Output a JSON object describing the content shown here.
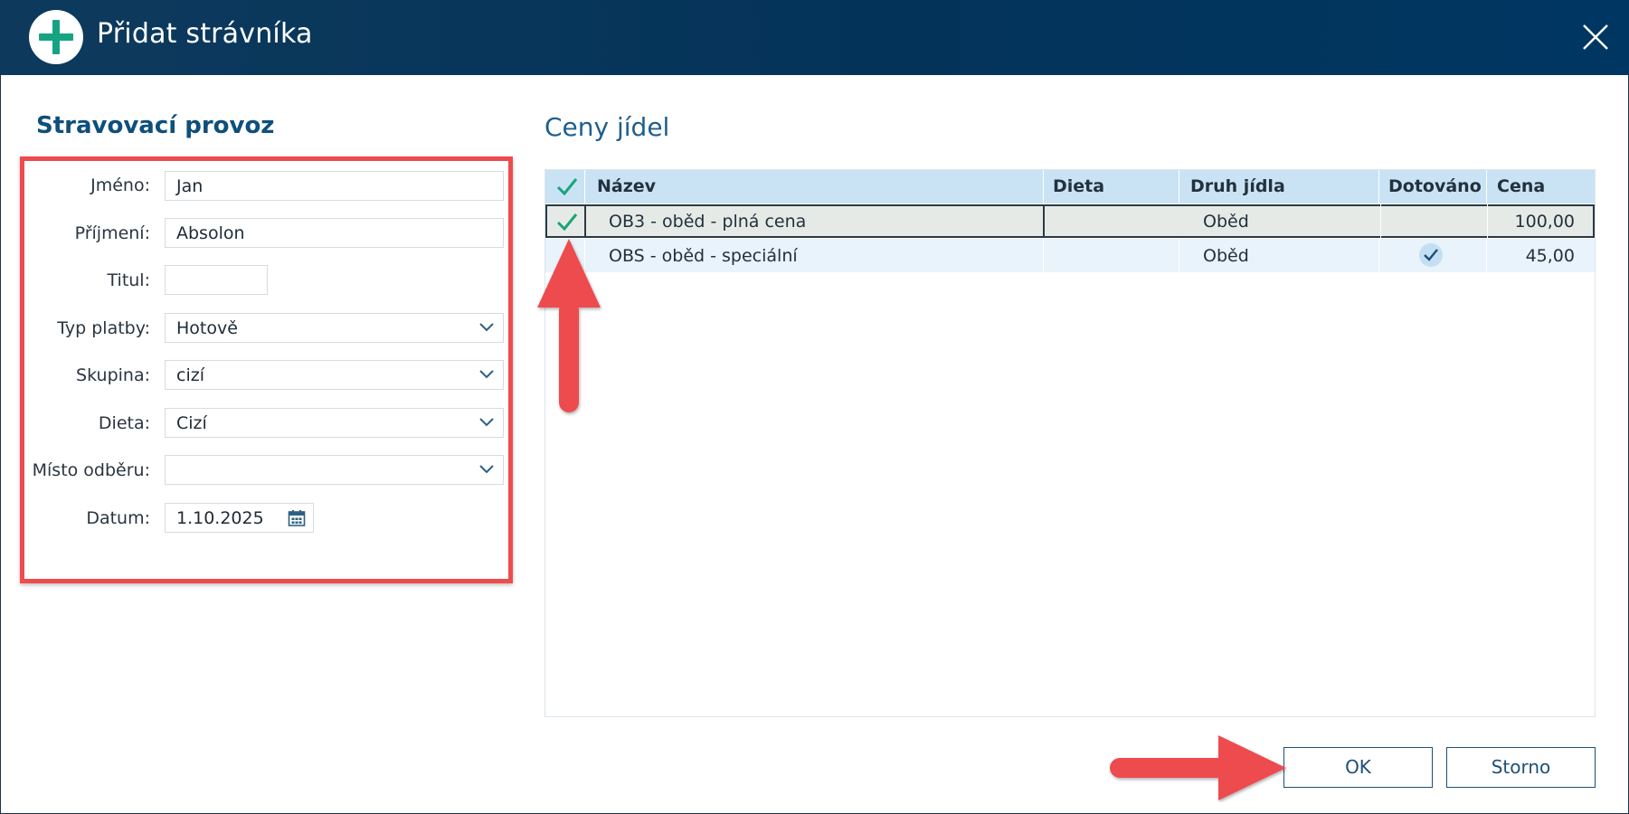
{
  "window": {
    "title": "Přidat strávníka"
  },
  "form": {
    "section_title": "Stravovací provoz",
    "fields": {
      "jmeno": {
        "label": "Jméno:",
        "value": "Jan"
      },
      "prijmeni": {
        "label": "Příjmení:",
        "value": "Absolon"
      },
      "titul": {
        "label": "Titul:",
        "value": ""
      },
      "typ_platby": {
        "label": "Typ platby:",
        "value": "Hotově"
      },
      "skupina": {
        "label": "Skupina:",
        "value": "cizí"
      },
      "dieta": {
        "label": "Dieta:",
        "value": "Cizí"
      },
      "misto_odberu": {
        "label": "Místo odběru:",
        "value": ""
      },
      "datum": {
        "label": "Datum:",
        "value": "1.10.2025"
      }
    }
  },
  "prices": {
    "title": "Ceny jídel",
    "columns": {
      "nazev": "Název",
      "dieta": "Dieta",
      "druh": "Druh jídla",
      "dotovano": "Dotováno",
      "cena": "Cena"
    },
    "rows": [
      {
        "selected": true,
        "nazev": "OB3 - oběd - plná cena",
        "dieta": "",
        "druh": "Oběd",
        "dotovano": false,
        "cena": "100,00"
      },
      {
        "selected": false,
        "nazev": "OBS - oběd - speciální",
        "dieta": "",
        "druh": "Oběd",
        "dotovano": true,
        "cena": "45,00"
      }
    ]
  },
  "buttons": {
    "ok": "OK",
    "storno": "Storno"
  },
  "colors": {
    "accent": "#0e4f7c",
    "titlebar": "#04335a",
    "check": "#1aa37a",
    "annotation": "#ee4b4f"
  },
  "icons": {
    "title": "plus-circle-icon",
    "close": "close-icon",
    "dropdown": "chevron-down-icon",
    "date": "calendar-icon",
    "check": "check-icon"
  }
}
